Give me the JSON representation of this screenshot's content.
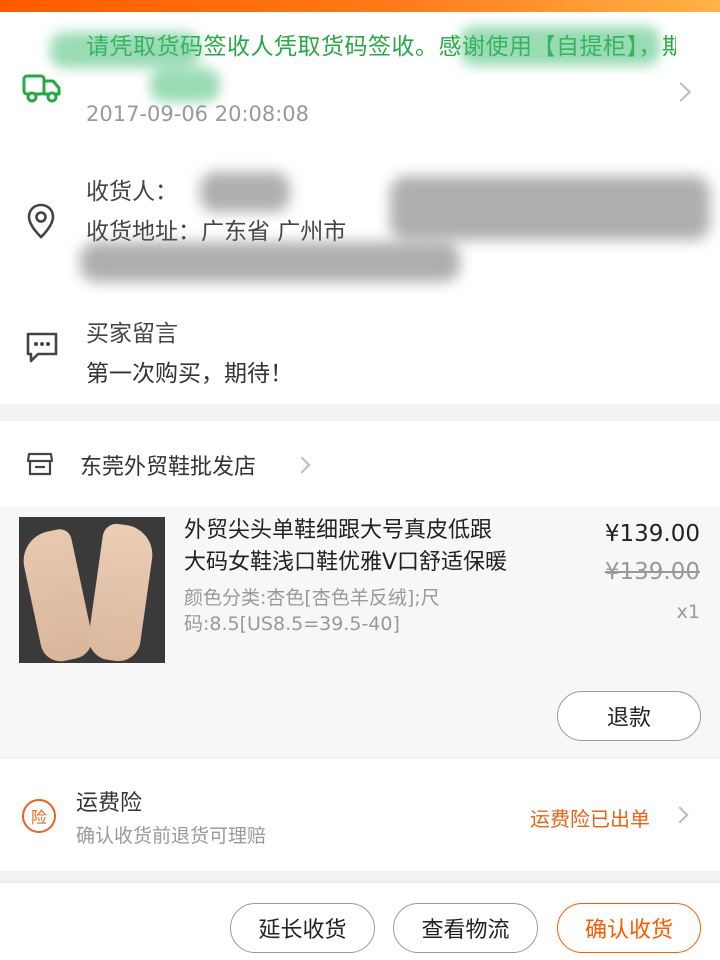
{
  "logistics": {
    "message": "请凭取货码签收人凭取货码签收。感谢使用【自提柜】，期待再次为您服务。",
    "time": "2017-09-06 20:08:08"
  },
  "address": {
    "recipient_label": "收货人：",
    "address_label": "收货地址：广东省 广州市"
  },
  "message": {
    "title": "买家留言",
    "body": "第一次购买，期待！"
  },
  "shop": {
    "name": "东莞外贸鞋批发店"
  },
  "product": {
    "title_line1": "外贸尖头单鞋细跟大号真皮低跟",
    "title_line2": "大码女鞋浅口鞋优雅V口舒适保暖",
    "spec": "颜色分类:杏色[杏色羊反绒];尺码:8.5[US8.5=39.5-40]",
    "price": "¥139.00",
    "original_price": "¥139.00",
    "quantity": "x1",
    "refund_label": "退款"
  },
  "insurance": {
    "icon_text": "险",
    "title": "运费险",
    "subtitle": "确认收货前退货可理赔",
    "status": "运费险已出单"
  },
  "actions": {
    "extend_label": "延长收货",
    "track_label": "查看物流",
    "confirm_label": "确认收货"
  },
  "colors": {
    "accent": "#ff5a00",
    "logistics_green": "#28a745",
    "insurance_orange": "#e8621a"
  }
}
